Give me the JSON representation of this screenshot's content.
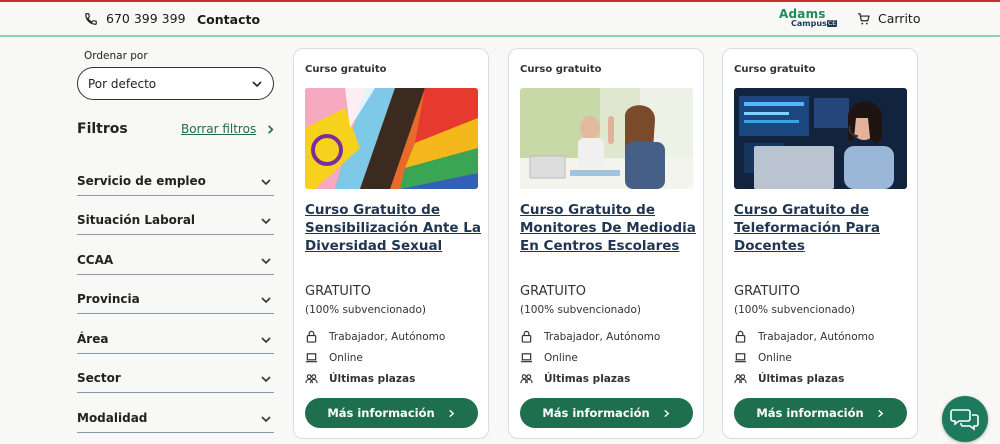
{
  "header": {
    "phone": "670 399 399",
    "contact": "Contacto",
    "logo_main": "Adams",
    "logo_sub": "Campus",
    "logo_badge": "CE",
    "cart": "Carrito"
  },
  "sidebar": {
    "sort_label": "Ordenar por",
    "sort_value": "Por defecto",
    "filters_title": "Filtros",
    "clear_filters": "Borrar filtros",
    "filters": [
      "Servicio de empleo",
      "Situación Laboral",
      "CCAA",
      "Provincia",
      "Área",
      "Sector",
      "Modalidad"
    ]
  },
  "cards": [
    {
      "tag": "Curso gratuito",
      "title": "Curso Gratuito de Sensibilización Ante La Diversidad Sexual",
      "price": "GRATUITO",
      "sub": "(100% subvencionado)",
      "audience": "Trabajador, Autónomo",
      "mode": "Online",
      "availability": "Últimas plazas",
      "button": "Más información"
    },
    {
      "tag": "Curso gratuito",
      "title": "Curso Gratuito de Monitores De Mediodia En Centros Escolares",
      "price": "GRATUITO",
      "sub": "(100% subvencionado)",
      "audience": "Trabajador, Autónomo",
      "mode": "Online",
      "availability": "Últimas plazas",
      "button": "Más información"
    },
    {
      "tag": "Curso gratuito",
      "title": "Curso Gratuito de Teleformación Para Docentes",
      "price": "GRATUITO",
      "sub": "(100% subvencionado)",
      "audience": "Trabajador, Autónomo",
      "mode": "Online",
      "availability": "Últimas plazas",
      "button": "Más información"
    }
  ],
  "colors": {
    "accent_green": "#1e6f4d",
    "title_navy": "#1f3550",
    "background": "#f8f8f6"
  }
}
